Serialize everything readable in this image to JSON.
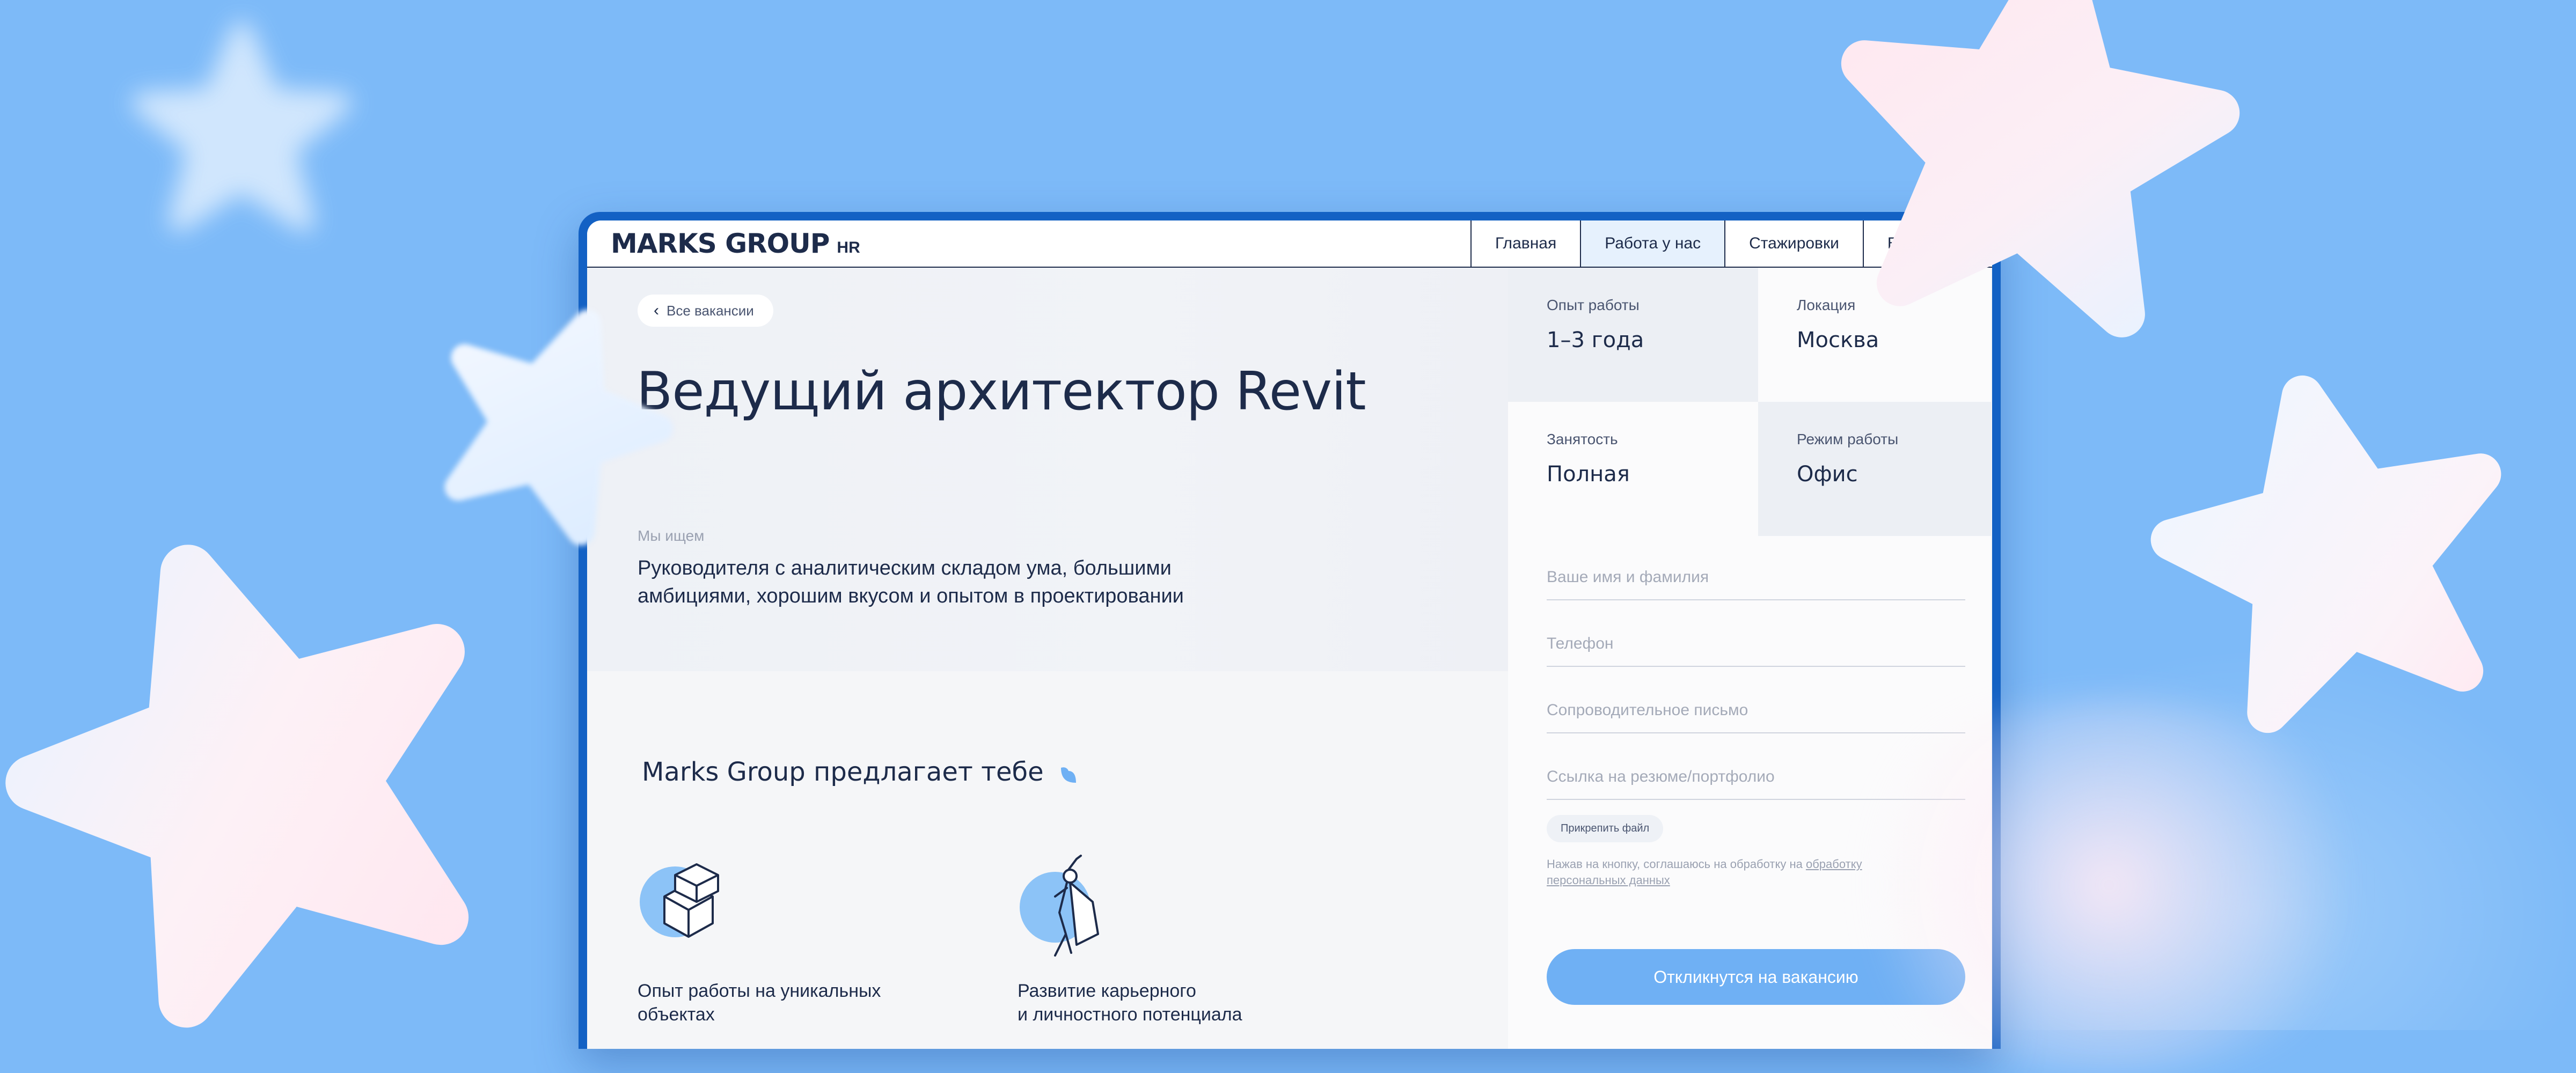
{
  "brand": {
    "logo": "MARKS GROUP",
    "logo_sub": "HR",
    "colors": {
      "background": "#7dbaf8",
      "frame": "#1361c4",
      "accent": "#6fb0f4",
      "text": "#1d2b4a"
    }
  },
  "nav": {
    "items": [
      {
        "label": "Главная"
      },
      {
        "label": "Работа у нас",
        "active": true
      },
      {
        "label": "Стажировки"
      },
      {
        "label": "EN |"
      }
    ]
  },
  "hero": {
    "back_label": "Все вакансии",
    "title": "Ведущий архитектор Revit",
    "lookfor_label": "Мы ищем",
    "lookfor_text": "Руководителя с аналитическим складом ума, большими амбициями, хорошим вкусом и опытом в проектировании"
  },
  "facts": [
    {
      "label": "Опыт работы",
      "value": "1–3 года"
    },
    {
      "label": "Локация",
      "value": "Москва"
    },
    {
      "label": "Занятость",
      "value": "Полная"
    },
    {
      "label": "Режим работы",
      "value": "Офис"
    }
  ],
  "offers": {
    "title": "Marks Group предлагает тебе",
    "items": [
      {
        "icon": "building-blocks-icon",
        "text": "Опыт работы на уникальных\nобъектах"
      },
      {
        "icon": "superhero-icon",
        "text": "Развитие карьерного\nи личностного потенциала"
      }
    ]
  },
  "form": {
    "name_placeholder": "Ваше имя и фамилия",
    "phone_placeholder": "Телефон",
    "letter_placeholder": "Сопроводительное письмо",
    "link_placeholder": "Ссылка на резюме/портфолио",
    "attach_label": "Прикрепить файл",
    "consent_text": "Нажав на кнопку, соглашаюсь на обработку на ",
    "consent_link": "обработку персональных данных",
    "submit_label": "Откликнутся на вакансию"
  }
}
